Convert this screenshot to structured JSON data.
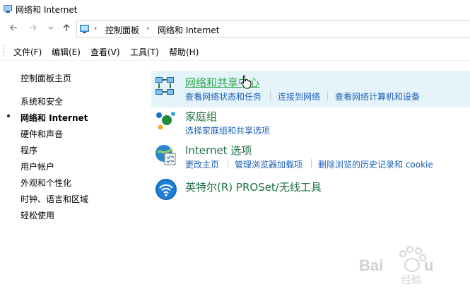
{
  "window": {
    "title": "网络和 Internet",
    "app_icon": "network-folder-icon"
  },
  "nav": {
    "back_icon": "back-arrow-icon",
    "forward_icon": "forward-arrow-icon",
    "recent_icon": "chevron-down-icon",
    "up_icon": "up-arrow-icon"
  },
  "address": {
    "icon": "control-panel-icon",
    "crumbs": [
      "控制面板",
      "网络和 Internet"
    ]
  },
  "menu": [
    "文件(F)",
    "编辑(E)",
    "查看(V)",
    "工具(T)",
    "帮助(H)"
  ],
  "sidebar": {
    "home": "控制面板主页",
    "items": [
      "系统和安全",
      "网络和 Internet",
      "硬件和声音",
      "程序",
      "用户帐户",
      "外观和个性化",
      "时钟、语言和区域",
      "轻松使用"
    ],
    "active_index": 1
  },
  "categories": [
    {
      "title": "网络和共享中心",
      "icon": "network-sharing-icon",
      "links": [
        "查看网络状态和任务",
        "连接到网络",
        "查看网络计算机和设备"
      ]
    },
    {
      "title": "家庭组",
      "icon": "homegroup-icon",
      "links": [
        "选择家庭组和共享选项"
      ]
    },
    {
      "title": "Internet 选项",
      "icon": "internet-options-icon",
      "links": [
        "更改主页",
        "管理浏览器加载项",
        "删除浏览的历史记录和 cookie"
      ]
    },
    {
      "title": "英特尔(R) PROSet/无线工具",
      "icon": "wifi-icon",
      "links": []
    }
  ],
  "watermark": "Baidu 经验",
  "colors": {
    "category_title": "#1e7145",
    "category_hover": "#2aa84a",
    "link": "#1a5fb4",
    "hover_bg": "#e5f3fb"
  }
}
